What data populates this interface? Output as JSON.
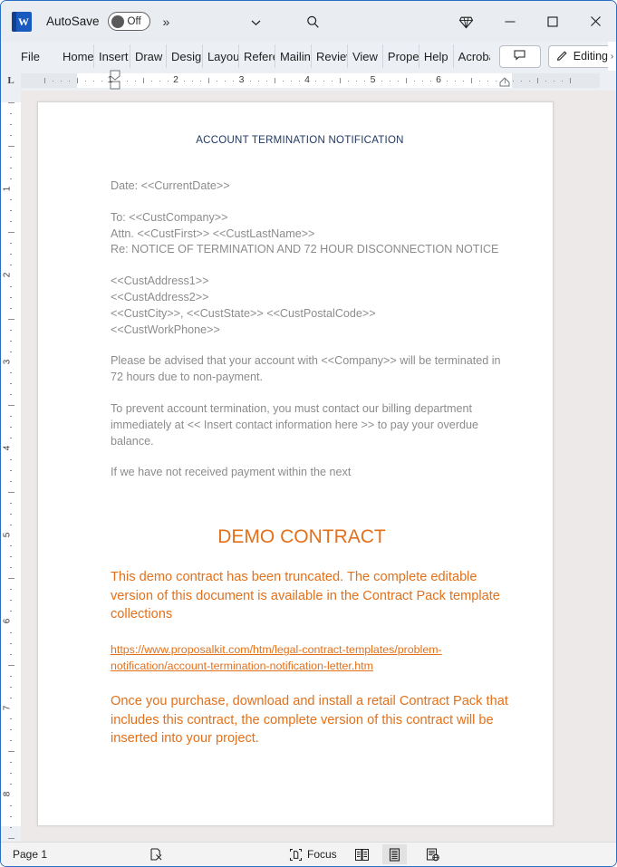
{
  "titlebar": {
    "app_icon": "word-logo-icon",
    "autosave_label": "AutoSave",
    "autosave_state": "Off",
    "more_commands": "»",
    "customize_quick_access": "chevron-down-icon",
    "search": "search-icon",
    "diamond": "diamond-icon",
    "minimize": "minimize-icon",
    "maximize": "maximize-icon",
    "close": "close-icon"
  },
  "ribbon": {
    "tabs": [
      {
        "label": "File"
      },
      {
        "label": "Home"
      },
      {
        "label": "Insert"
      },
      {
        "label": "Draw"
      },
      {
        "label": "Design"
      },
      {
        "label": "Layout"
      },
      {
        "label": "References"
      },
      {
        "label": "Mailings"
      },
      {
        "label": "Review"
      },
      {
        "label": "View"
      },
      {
        "label": "Properties"
      },
      {
        "label": "Help"
      },
      {
        "label": "Acrobat"
      }
    ],
    "comments_label": "",
    "editing_label": "Editing",
    "editing_caret": "›"
  },
  "ruler": {
    "tab_stop_marker": "L",
    "h_numbers": [
      "1",
      "2",
      "3",
      "4",
      "5"
    ],
    "v_numbers": [
      "1",
      "2",
      "3",
      "4",
      "5",
      "6",
      "7",
      "8"
    ]
  },
  "document": {
    "title": "ACCOUNT TERMINATION NOTIFICATION",
    "paragraphs": [
      "Date: <<CurrentDate>>",
      "To: <<CustCompany>>",
      "Attn. <<CustFirst>> <<CustLastName>>",
      "Re: NOTICE OF TERMINATION AND 72 HOUR DISCONNECTION NOTICE",
      "<<CustAddress1>>",
      "<<CustAddress2>>",
      "<<CustCity>>, <<CustState>> <<CustPostalCode>>",
      "<<CustWorkPhone>>",
      "Please be advised that your account with <<Company>> will be terminated in 72 hours due to non-payment.",
      "To prevent account termination, you must contact our billing department immediately at << Insert contact information here >> to pay your overdue balance.",
      "If we have not received payment within the next"
    ],
    "demo_heading": "DEMO CONTRACT",
    "demo_paragraph_1": "This demo contract has been truncated. The complete editable version of this document is available in the Contract Pack template collections",
    "demo_link": "https://www.proposalkit.com/htm/legal-contract-templates/problem-notification/account-termination-notification-letter.htm",
    "demo_paragraph_2": "Once you purchase, download and install a retail Contract Pack that includes this contract, the complete version of this contract will be inserted into your project."
  },
  "statusbar": {
    "page_label": "Page 1",
    "proofing_icon": "proofing-errors-icon",
    "focus_label": "Focus",
    "focus_icon": "focus-icon",
    "read_mode_icon": "read-mode-icon",
    "print_layout_icon": "print-layout-icon",
    "web_layout_icon": "web-layout-icon"
  },
  "colors": {
    "title_blue": "#1f3864",
    "demo_orange": "#e3701a",
    "body_gray": "#8c8c8c",
    "window_border": "#2a6ec4",
    "chrome": "#eceff4",
    "workspace": "#ece9e8"
  }
}
